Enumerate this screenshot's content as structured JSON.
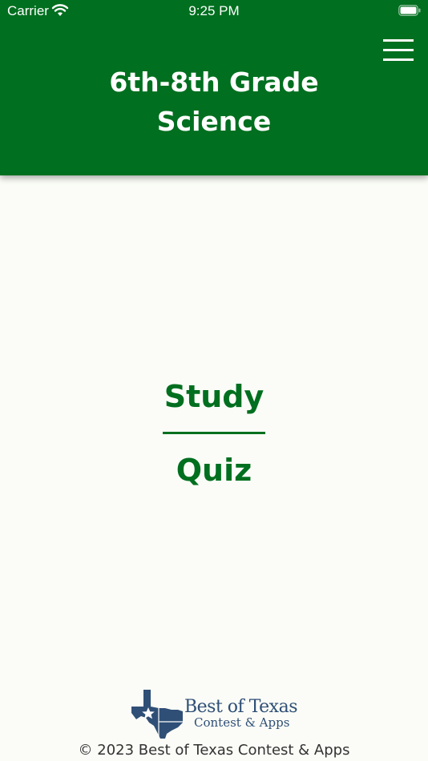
{
  "status_bar": {
    "carrier": "Carrier",
    "time": "9:25 PM"
  },
  "header": {
    "title_line1": "6th-8th Grade",
    "title_line2": "Science",
    "menu_icon": "hamburger-menu-icon"
  },
  "menu": {
    "study_label": "Study",
    "quiz_label": "Quiz"
  },
  "footer": {
    "logo_line1": "Best of Texas",
    "logo_line2": "Contest & Apps",
    "copyright": "© 2023 Best of Texas Contest & Apps"
  },
  "colors": {
    "header_green": "#006f1f",
    "background": "#fbfcf7",
    "logo_blue": "#2f4f76"
  }
}
